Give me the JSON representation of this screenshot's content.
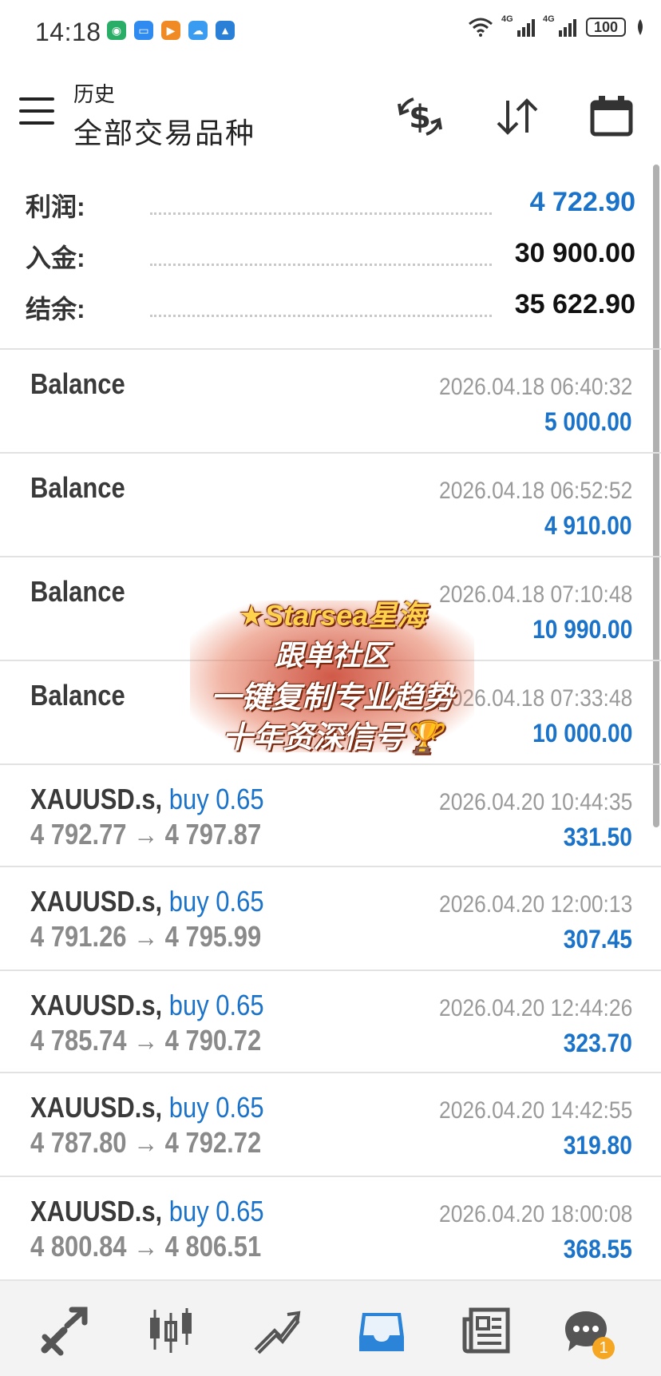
{
  "status_bar": {
    "time": "14:18",
    "battery": "100",
    "network_1": "4G",
    "network_2": "4G"
  },
  "header": {
    "subtitle": "历史",
    "title": "全部交易品种"
  },
  "summary": {
    "profit_label": "利润:",
    "profit_value": "4 722.90",
    "deposit_label": "入金:",
    "deposit_value": "30 900.00",
    "balance_label": "结余:",
    "balance_value": "35 622.90"
  },
  "deals": [
    {
      "title": "Balance",
      "buy": "",
      "prices": "",
      "time": "2026.04.18 06:40:32",
      "profit": "5 000.00"
    },
    {
      "title": "Balance",
      "buy": "",
      "prices": "",
      "time": "2026.04.18 06:52:52",
      "profit": "4 910.00"
    },
    {
      "title": "Balance",
      "buy": "",
      "prices": "",
      "time": "2026.04.18 07:10:48",
      "profit": "10 990.00"
    },
    {
      "title": "Balance",
      "buy": "",
      "prices": "",
      "time": "2026.04.18 07:33:48",
      "profit": "10 000.00"
    },
    {
      "title": "XAUUSD.s,",
      "buy": "buy 0.65",
      "prices": "4 792.77 → 4 797.87",
      "time": "2026.04.20 10:44:35",
      "profit": "331.50"
    },
    {
      "title": "XAUUSD.s,",
      "buy": "buy 0.65",
      "prices": "4 791.26 → 4 795.99",
      "time": "2026.04.20 12:00:13",
      "profit": "307.45"
    },
    {
      "title": "XAUUSD.s,",
      "buy": "buy 0.65",
      "prices": "4 785.74 → 4 790.72",
      "time": "2026.04.20 12:44:26",
      "profit": "323.70"
    },
    {
      "title": "XAUUSD.s,",
      "buy": "buy 0.65",
      "prices": "4 787.80 → 4 792.72",
      "time": "2026.04.20 14:42:55",
      "profit": "319.80"
    },
    {
      "title": "XAUUSD.s,",
      "buy": "buy 0.65",
      "prices": "4 800.84 → 4 806.51",
      "time": "2026.04.20 18:00:08",
      "profit": "368.55"
    }
  ],
  "watermark": {
    "line1": "Starsea星海",
    "line2": "跟单社区",
    "line3": "一键复制专业趋势",
    "line4": "十年资深信号"
  },
  "bottom_nav": {
    "chat_badge": "1"
  },
  "colors": {
    "accent_blue": "#1a73c9",
    "text_dark": "#222222",
    "text_gray": "#8a8a8a"
  }
}
